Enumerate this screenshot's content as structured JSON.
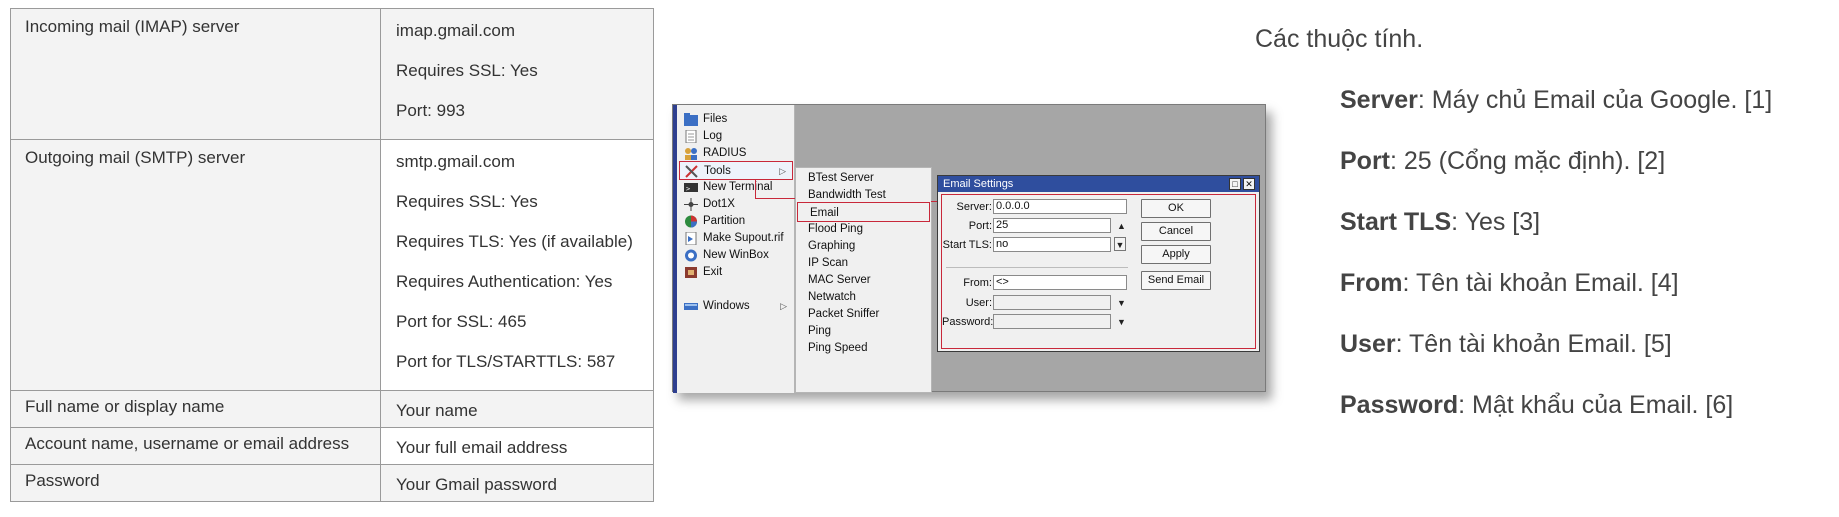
{
  "table": {
    "rows": [
      {
        "label": "Incoming mail (IMAP) server",
        "values": [
          "imap.gmail.com",
          "Requires SSL: Yes",
          "Port: 993"
        ]
      },
      {
        "label": "Outgoing mail (SMTP) server",
        "values": [
          "smtp.gmail.com",
          "Requires SSL: Yes",
          "Requires TLS: Yes (if available)",
          "Requires Authentication: Yes",
          "Port for SSL: 465",
          "Port for TLS/STARTTLS: 587"
        ]
      },
      {
        "label": "Full name or display name",
        "values": [
          "Your name"
        ]
      },
      {
        "label": "Account name, username or email address",
        "values": [
          "Your full email address"
        ]
      },
      {
        "label": "Password",
        "values": [
          "Your Gmail password"
        ]
      }
    ]
  },
  "winbox": {
    "menu": [
      {
        "label": "Files",
        "icon": "folder-icon"
      },
      {
        "label": "Log",
        "icon": "log-icon"
      },
      {
        "label": "RADIUS",
        "icon": "users-icon"
      },
      {
        "label": "Tools",
        "icon": "tools-icon"
      },
      {
        "label": "New Terminal",
        "icon": "terminal-icon"
      },
      {
        "label": "Dot1X",
        "icon": "dot1x-icon"
      },
      {
        "label": "Partition",
        "icon": "partition-icon"
      },
      {
        "label": "Make Supout.rif",
        "icon": "supout-icon"
      },
      {
        "label": "New WinBox",
        "icon": "winbox-icon"
      },
      {
        "label": "Exit",
        "icon": "exit-icon"
      },
      {
        "label": "Windows",
        "icon": "windows-icon"
      }
    ],
    "submenu": [
      "BTest Server",
      "Bandwidth Test",
      "Email",
      "Flood Ping",
      "Graphing",
      "IP Scan",
      "MAC Server",
      "Netwatch",
      "Packet Sniffer",
      "Ping",
      "Ping Speed"
    ],
    "dialog": {
      "title": "Email Settings",
      "server_label": "Server:",
      "server_value": "0.0.0.0",
      "port_label": "Port:",
      "port_value": "25",
      "starttls_label": "Start TLS:",
      "starttls_value": "no",
      "from_label": "From:",
      "from_value": "<>",
      "user_label": "User:",
      "user_value": "",
      "password_label": "Password:",
      "password_value": "",
      "ok_label": "OK",
      "cancel_label": "Cancel",
      "apply_label": "Apply",
      "send_label": "Send Email"
    }
  },
  "props": {
    "title": "Các thuộc tính.",
    "items": [
      {
        "name": "Server",
        "desc": ": Máy chủ Email của Google. [1]"
      },
      {
        "name": "Port",
        "desc": ": 25 (Cổng mặc định). [2]"
      },
      {
        "name": "Start TLS",
        "desc": ": Yes [3]"
      },
      {
        "name": "From",
        "desc": ": Tên tài khoản Email. [4]"
      },
      {
        "name": "User",
        "desc": ": Tên tài khoản Email. [5]"
      },
      {
        "name": "Password",
        "desc": ": Mật khẩu của Email. [6]"
      }
    ]
  }
}
